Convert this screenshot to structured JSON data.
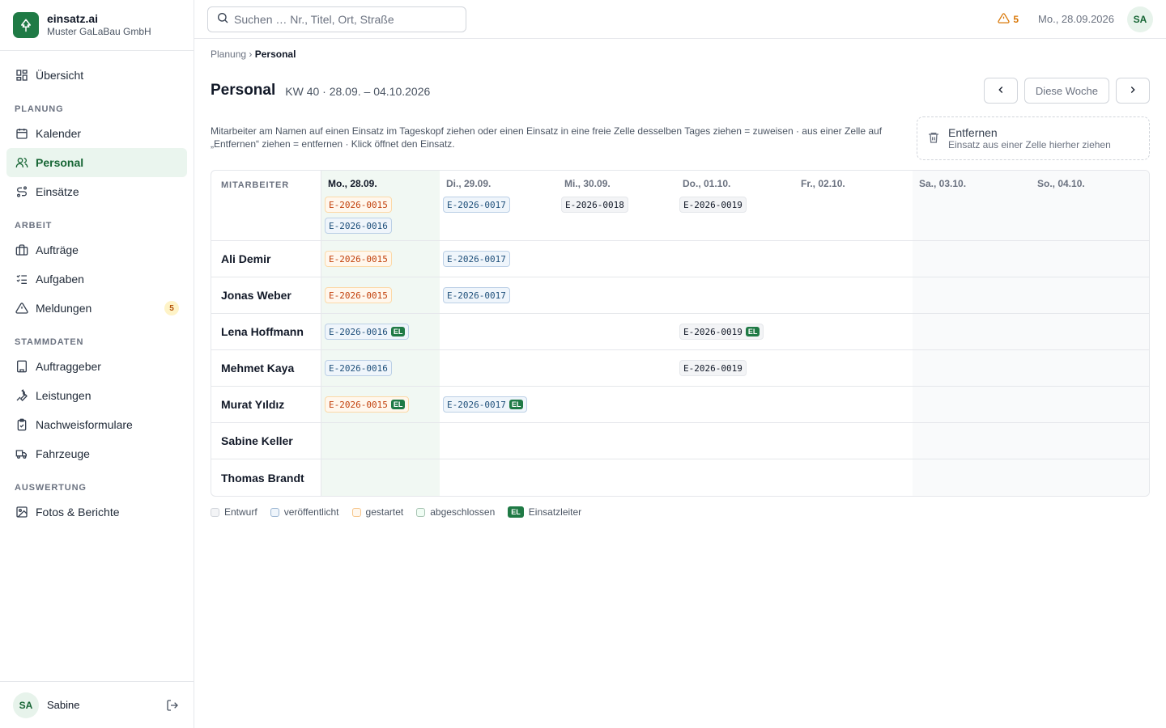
{
  "brand": {
    "name": "einsatz.ai",
    "company": "Muster GaLaBau GmbH"
  },
  "nav": {
    "overview": "Übersicht",
    "sections": {
      "planung": "PLANUNG",
      "arbeit": "ARBEIT",
      "stammdaten": "STAMMDATEN",
      "auswertung": "AUSWERTUNG"
    },
    "items": {
      "kalender": "Kalender",
      "personal": "Personal",
      "einsaetze": "Einsätze",
      "auftraege": "Aufträge",
      "aufgaben": "Aufgaben",
      "meldungen": "Meldungen",
      "meldungen_count": "5",
      "auftraggeber": "Auftraggeber",
      "leistungen": "Leistungen",
      "nachweisformulare": "Nachweisformulare",
      "fahrzeuge": "Fahrzeuge",
      "fotos": "Fotos & Berichte"
    },
    "active": "personal"
  },
  "user": {
    "initials": "SA",
    "name": "Sabine"
  },
  "topbar": {
    "search_placeholder": "Suchen … Nr., Titel, Ort, Straße",
    "warnings": "5",
    "date": "Mo., 28.09.2026",
    "avatar": "SA"
  },
  "breadcrumb": {
    "parent": "Planung",
    "sep": "›",
    "current": "Personal"
  },
  "page": {
    "title": "Personal",
    "week": "KW 40 · 28.09. – 04.10.2026",
    "this_week": "Diese Woche",
    "hint": "Mitarbeiter am Namen auf einen Einsatz im Tageskopf ziehen oder einen Einsatz in eine freie Zelle desselben Tages ziehen = zuweisen · aus einer Zelle auf „Entfernen“ ziehen = entfernen · Klick öffnet den Einsatz.",
    "remove_title": "Entfernen",
    "remove_sub": "Einsatz aus einer Zelle hierher ziehen"
  },
  "grid": {
    "employee_header": "MITARBEITER",
    "days": [
      {
        "label": "Mo., 28.09.",
        "today": true,
        "weekend": false
      },
      {
        "label": "Di., 29.09.",
        "today": false,
        "weekend": false
      },
      {
        "label": "Mi., 30.09.",
        "today": false,
        "weekend": false
      },
      {
        "label": "Do., 01.10.",
        "today": false,
        "weekend": false
      },
      {
        "label": "Fr., 02.10.",
        "today": false,
        "weekend": false
      },
      {
        "label": "Sa., 03.10.",
        "today": false,
        "weekend": true
      },
      {
        "label": "So., 04.10.",
        "today": false,
        "weekend": true
      }
    ],
    "header_chips": [
      [
        {
          "id": "E-2026-0015",
          "status": "gestartet"
        },
        {
          "id": "E-2026-0016",
          "status": "veroeffentlicht"
        }
      ],
      [
        {
          "id": "E-2026-0017",
          "status": "veroeffentlicht"
        }
      ],
      [
        {
          "id": "E-2026-0018",
          "status": "entwurf"
        }
      ],
      [
        {
          "id": "E-2026-0019",
          "status": "entwurf"
        }
      ],
      [],
      [],
      []
    ],
    "el_label": "EL",
    "employees": [
      {
        "name": "Ali Demir",
        "cells": [
          [
            {
              "id": "E-2026-0015",
              "status": "gestartet",
              "el": false
            }
          ],
          [
            {
              "id": "E-2026-0017",
              "status": "veroeffentlicht",
              "el": false
            }
          ],
          [],
          [],
          [],
          [],
          []
        ]
      },
      {
        "name": "Jonas Weber",
        "cells": [
          [
            {
              "id": "E-2026-0015",
              "status": "gestartet",
              "el": false
            }
          ],
          [
            {
              "id": "E-2026-0017",
              "status": "veroeffentlicht",
              "el": false
            }
          ],
          [],
          [],
          [],
          [],
          []
        ]
      },
      {
        "name": "Lena Hoffmann",
        "cells": [
          [
            {
              "id": "E-2026-0016",
              "status": "veroeffentlicht",
              "el": true
            }
          ],
          [],
          [],
          [
            {
              "id": "E-2026-0019",
              "status": "entwurf",
              "el": true
            }
          ],
          [],
          [],
          []
        ]
      },
      {
        "name": "Mehmet Kaya",
        "cells": [
          [
            {
              "id": "E-2026-0016",
              "status": "veroeffentlicht",
              "el": false
            }
          ],
          [],
          [],
          [
            {
              "id": "E-2026-0019",
              "status": "entwurf",
              "el": false
            }
          ],
          [],
          [],
          []
        ]
      },
      {
        "name": "Murat Yıldız",
        "cells": [
          [
            {
              "id": "E-2026-0015",
              "status": "gestartet",
              "el": true
            }
          ],
          [
            {
              "id": "E-2026-0017",
              "status": "veroeffentlicht",
              "el": true
            }
          ],
          [],
          [],
          [],
          [],
          []
        ]
      },
      {
        "name": "Sabine Keller",
        "cells": [
          [],
          [],
          [],
          [],
          [],
          [],
          []
        ]
      },
      {
        "name": "Thomas Brandt",
        "cells": [
          [],
          [],
          [],
          [],
          [],
          [],
          []
        ]
      }
    ]
  },
  "legend": {
    "entwurf": "Entwurf",
    "veroeffentlicht": "veröffentlicht",
    "gestartet": "gestartet",
    "abgeschlossen": "abgeschlossen",
    "el": "EL",
    "einsatzleiter": "Einsatzleiter"
  },
  "colors": {
    "brand": "#1f7a45",
    "active_bg": "#eaf5ee",
    "gestartet": "#c2410c",
    "veroeffentlicht": "#1e4f7a",
    "warning": "#d97706"
  }
}
